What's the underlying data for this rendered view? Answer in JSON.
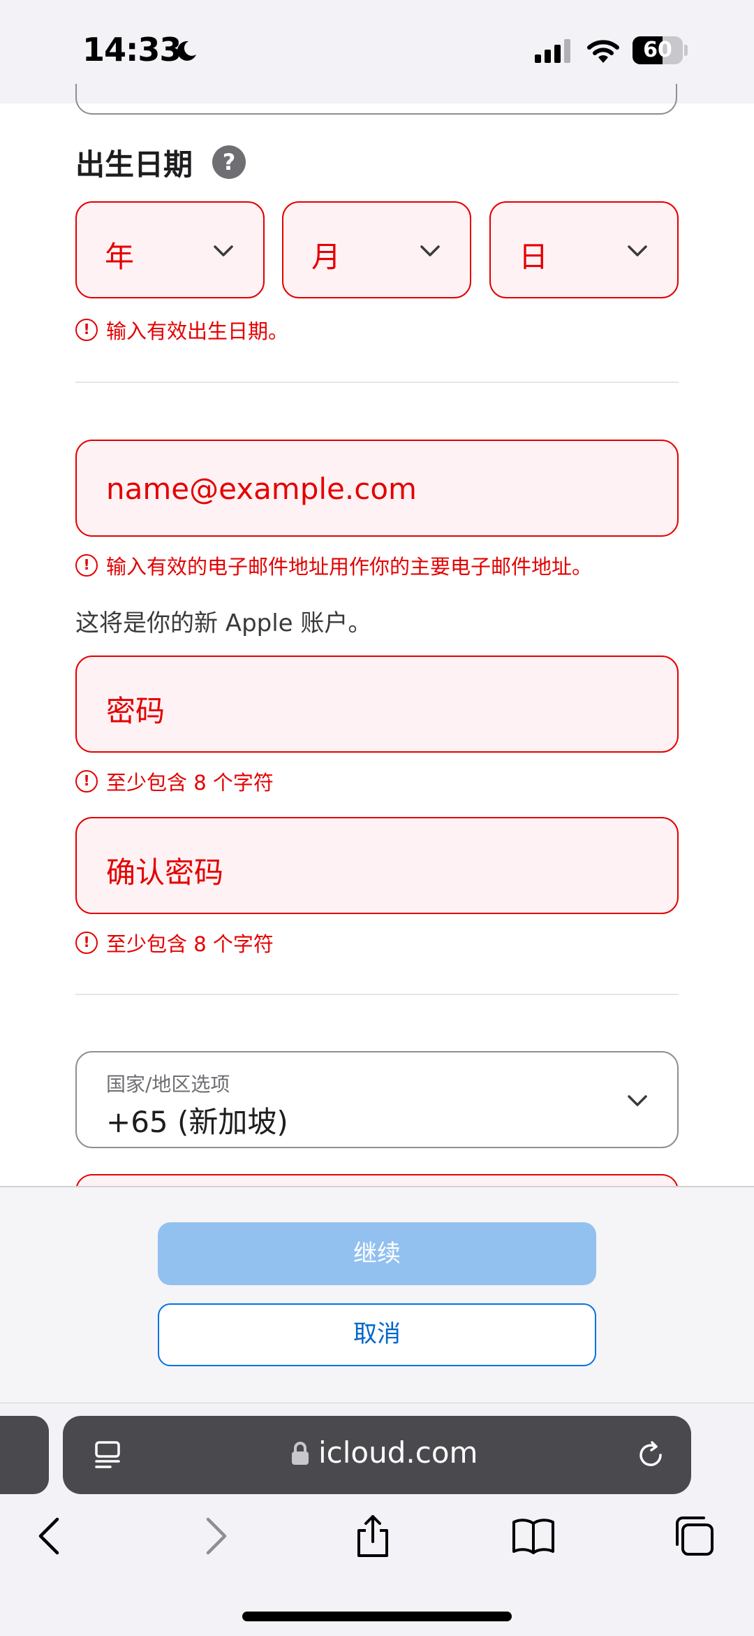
{
  "status_bar": {
    "time": "14:33",
    "battery_level": "60",
    "battery_fraction": 0.6
  },
  "birthdate": {
    "label": "出生日期",
    "help_glyph": "?",
    "year_placeholder": "年",
    "month_placeholder": "月",
    "day_placeholder": "日",
    "error": "输入有效出生日期。"
  },
  "email": {
    "placeholder": "name@example.com",
    "error": "输入有效的电子邮件地址用作你的主要电子邮件地址。",
    "info": "这将是你的新 Apple 账户。"
  },
  "password": {
    "placeholder": "密码",
    "error": "至少包含 8 个字符"
  },
  "confirm_password": {
    "placeholder": "确认密码",
    "error": "至少包含 8 个字符"
  },
  "country": {
    "caption": "国家/地区选项",
    "value": "+65 (新加坡)"
  },
  "actions": {
    "continue_label": "继续",
    "cancel_label": "取消"
  },
  "browser": {
    "url": "icloud.com"
  },
  "colors": {
    "error": "#e30000",
    "error_fill": "#fff2f4",
    "primary_disabled": "#92c1f0",
    "link_blue": "#0066cc",
    "url_bar": "#4a4a4e"
  },
  "icons": [
    "moon-icon",
    "signal-icon",
    "wifi-icon",
    "battery-icon",
    "help-icon",
    "chevron-down-icon",
    "error-icon",
    "reader-icon",
    "lock-icon",
    "reload-icon",
    "back-icon",
    "forward-icon",
    "share-icon",
    "bookmarks-icon",
    "tabs-icon"
  ]
}
